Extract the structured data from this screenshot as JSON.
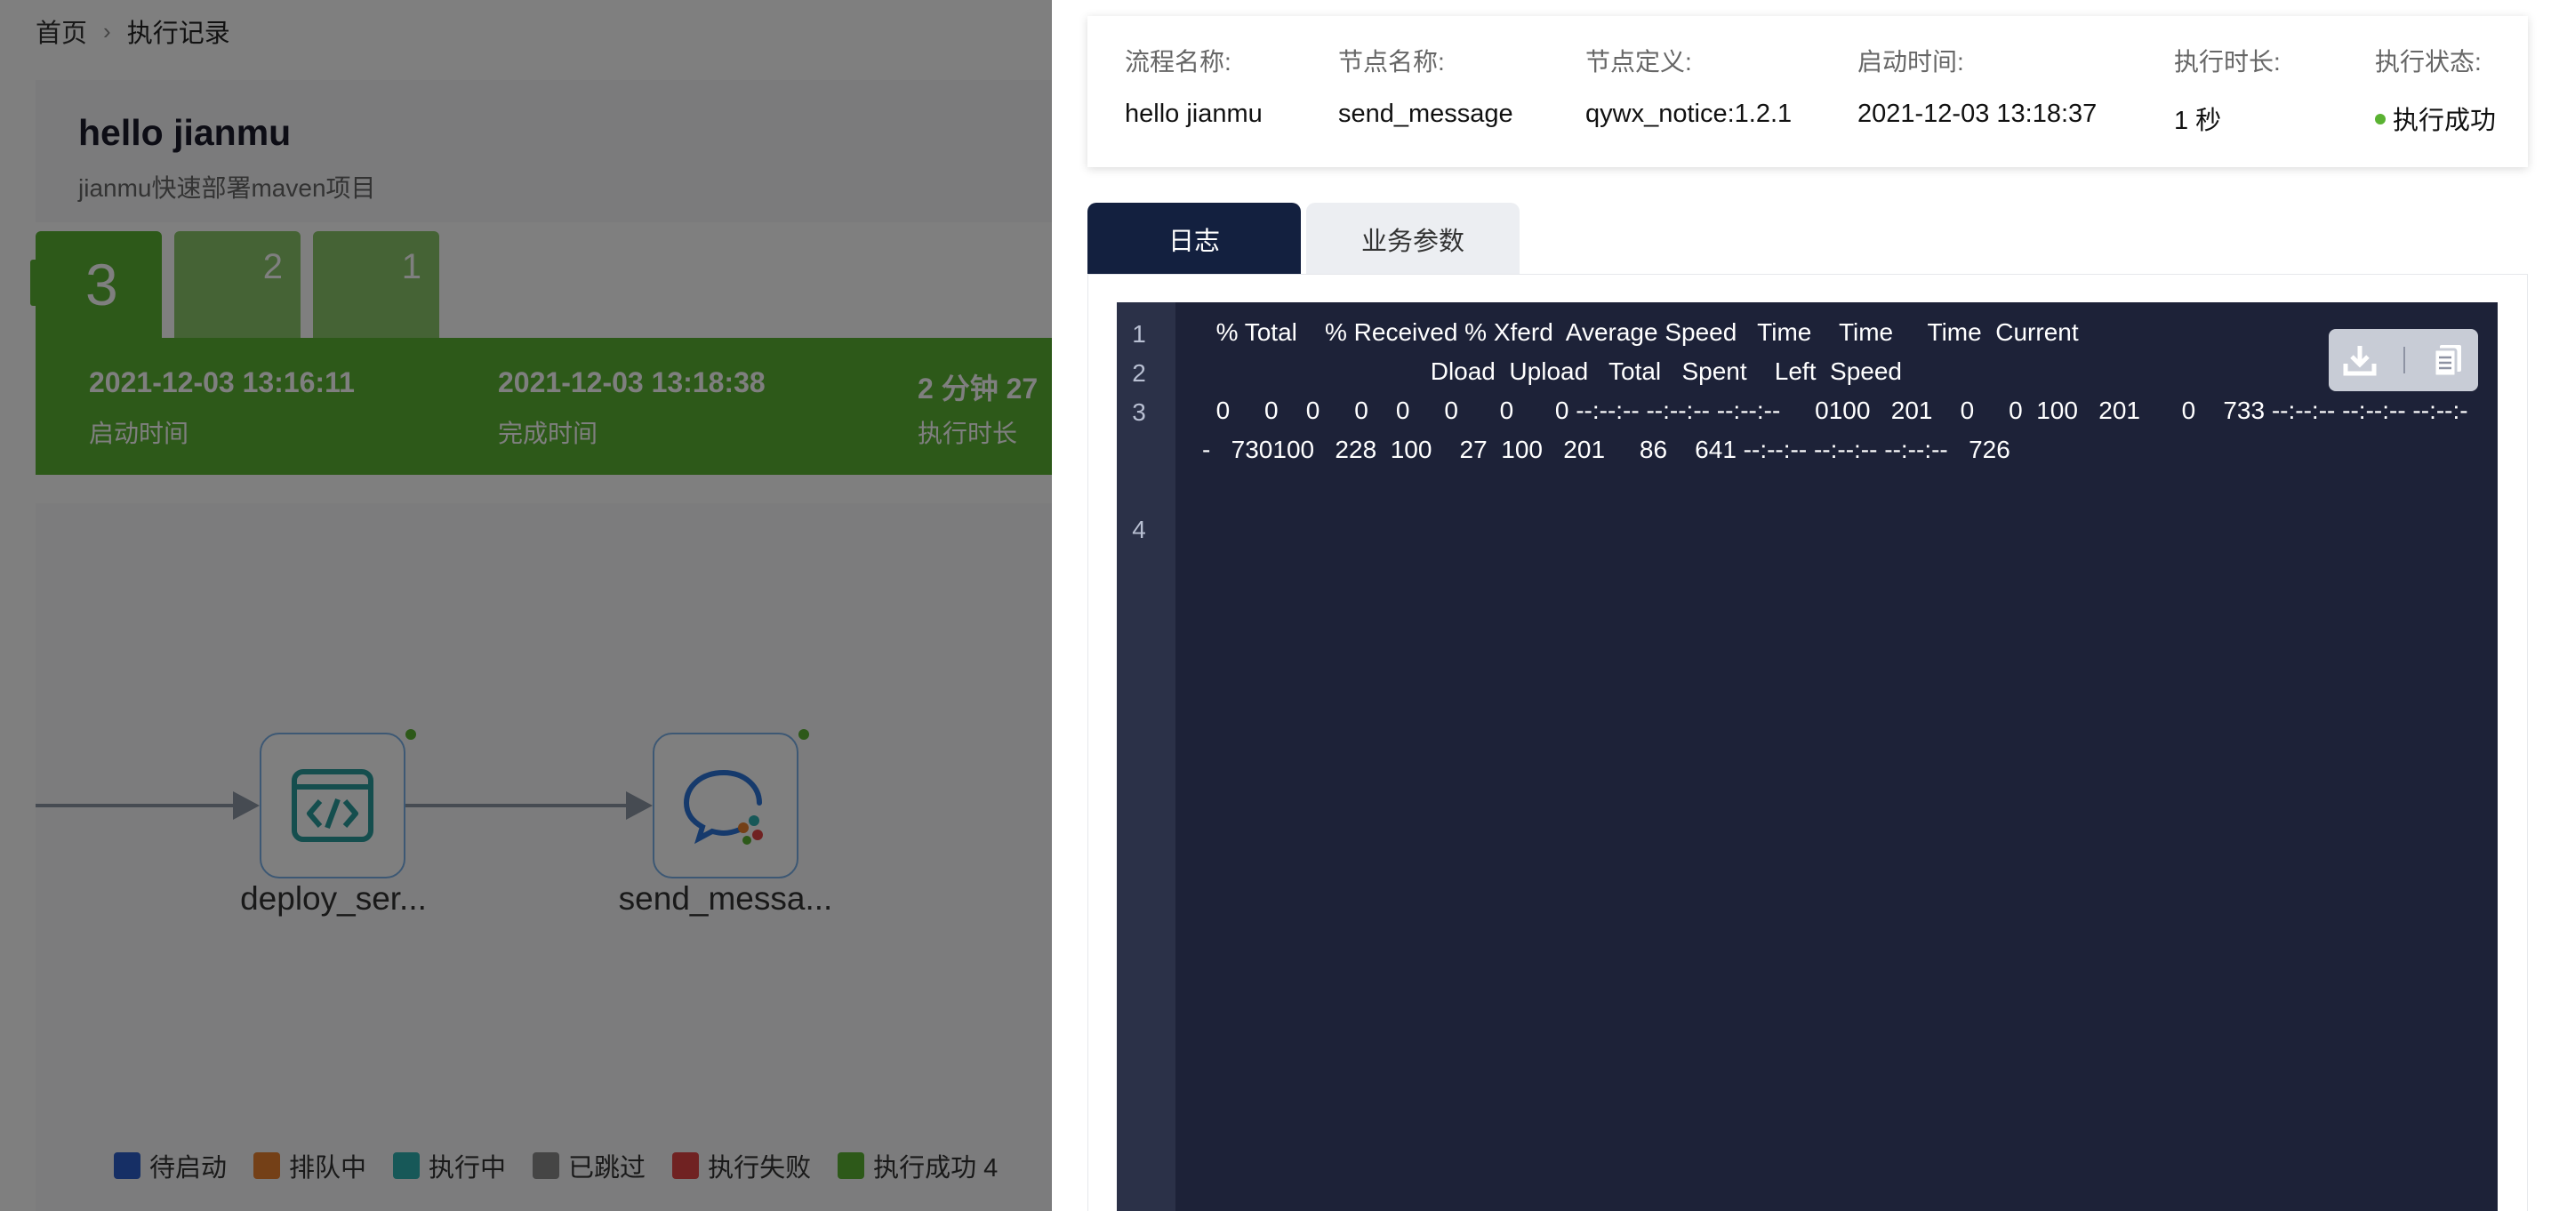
{
  "breadcrumb": {
    "home": "首页",
    "current": "执行记录"
  },
  "workflow": {
    "title": "hello jianmu",
    "description": "jianmu快速部署maven项目"
  },
  "records": [
    "3",
    "2",
    "1"
  ],
  "run": {
    "start_time": "2021-12-03 13:16:11",
    "start_label": "启动时间",
    "end_time": "2021-12-03 13:18:38",
    "end_label": "完成时间",
    "duration": "2 分钟 27",
    "duration_label": "执行时长"
  },
  "nodes": [
    {
      "label": "deploy_ser...",
      "icon": "code-icon"
    },
    {
      "label": "send_messa...",
      "icon": "wechat-work-icon"
    }
  ],
  "legend": [
    {
      "label": "待启动",
      "color": "#2d5ecb"
    },
    {
      "label": "排队中",
      "color": "#e8812e"
    },
    {
      "label": "执行中",
      "color": "#2eb0b0"
    },
    {
      "label": "已跳过",
      "color": "#8a8a8a"
    },
    {
      "label": "执行失败",
      "color": "#e04545"
    },
    {
      "label": "执行成功 4",
      "color": "#5ab232"
    }
  ],
  "drawer": {
    "info": {
      "flow_name_label": "流程名称:",
      "flow_name": "hello jianmu",
      "node_name_label": "节点名称:",
      "node_name": "send_message",
      "node_def_label": "节点定义:",
      "node_def": "qywx_notice:1.2.1",
      "start_time_label": "启动时间:",
      "start_time": "2021-12-03 13:18:37",
      "duration_label": "执行时长:",
      "duration": "1 秒",
      "status_label": "执行状态:",
      "status": "执行成功"
    },
    "tabs": {
      "log": "日志",
      "params": "业务参数"
    },
    "log_lines": [
      {
        "n": "1",
        "text": "  % Total    % Received % Xferd  Average Speed   Time    Time     Time  Current"
      },
      {
        "n": "2",
        "text": "                                 Dload  Upload   Total   Spent    Left  Speed"
      },
      {
        "n": "3",
        "text": "  0     0    0     0    0     0      0      0 --:--:-- --:--:-- --:--:--     0100   201    0     0  100   201      0    733 --:--:-- --:--:-- --:--:--   730100   228  100    27  100   201     86    641 --:--:-- --:--:-- --:--:--   726"
      },
      {
        "n": "4",
        "text": ""
      }
    ]
  }
}
